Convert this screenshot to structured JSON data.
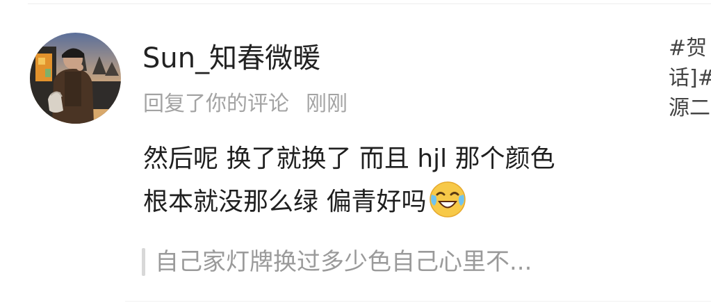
{
  "comment": {
    "username": "Sun_知春微暖",
    "action": "回复了你的评论",
    "time": "刚刚",
    "text_line1": "然后呢 换了就换了 而且 hjl 那个颜色",
    "text_line2": "根本就没那么绿 偏青好吗",
    "emoji": "laughing-crying-emoji",
    "quoted_text": "自己家灯牌换过多少色自己心里不..."
  },
  "original_post_preview": {
    "line1": "#贺",
    "line2": "话]#",
    "line3": "源二"
  },
  "colors": {
    "username": "#222222",
    "meta": "#a3a3a3",
    "body_text": "#1f1f1f",
    "quote_text": "#9a9a9a",
    "quote_bar": "#d8d8d8"
  }
}
